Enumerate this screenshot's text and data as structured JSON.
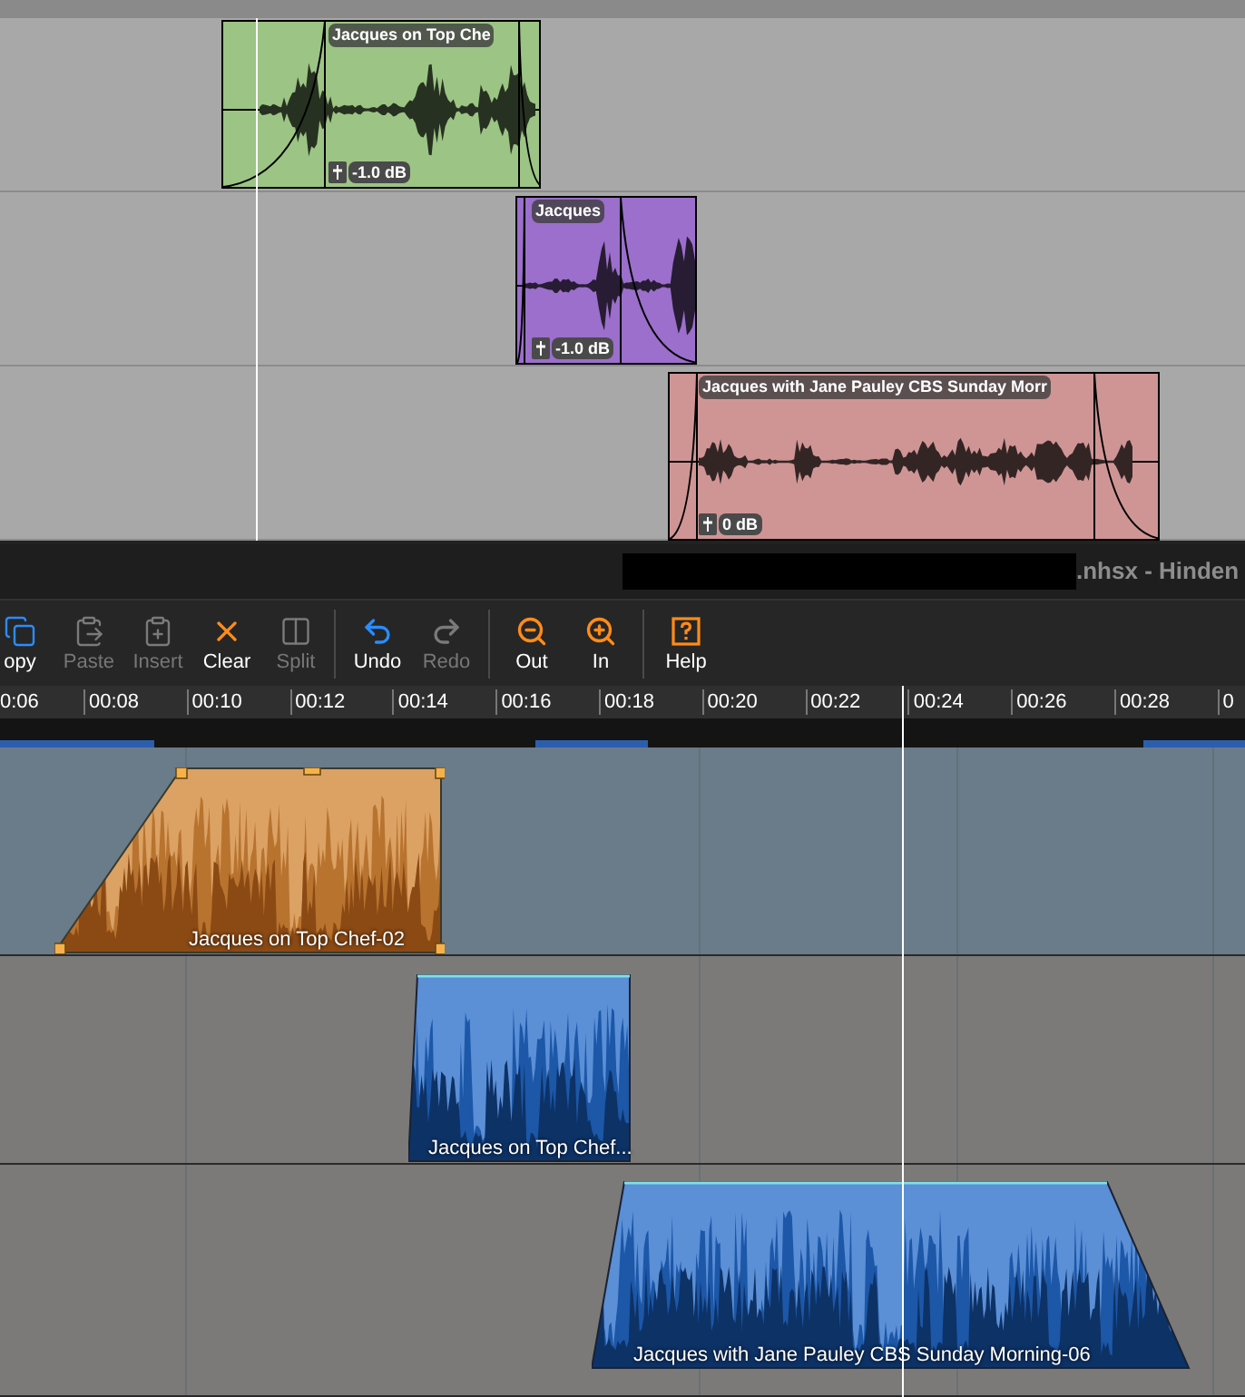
{
  "top_tracks": [
    {
      "clip": {
        "label": "Jacques on Top Che",
        "gain": "-1.0 dB",
        "color": "#9cc485"
      }
    },
    {
      "clip": {
        "label": "Jacques",
        "gain": "-1.0 dB",
        "color": "#9b6fcb"
      }
    },
    {
      "clip": {
        "label": "Jacques with Jane Pauley CBS Sunday Morr",
        "gain": "0 dB",
        "color": "#cf9595"
      }
    }
  ],
  "title_bar": {
    "title": ".nhsx - Hinden"
  },
  "toolbar": [
    [
      {
        "kind": "copy",
        "label": "opy",
        "disabled": false
      },
      {
        "kind": "paste",
        "label": "Paste",
        "disabled": true
      },
      {
        "kind": "insert",
        "label": "Insert",
        "disabled": true
      },
      {
        "kind": "clear",
        "label": "Clear",
        "disabled": false
      },
      {
        "kind": "split",
        "label": "Split",
        "disabled": true
      }
    ],
    [
      {
        "kind": "undo",
        "label": "Undo",
        "disabled": false
      },
      {
        "kind": "redo",
        "label": "Redo",
        "disabled": true
      }
    ],
    [
      {
        "kind": "zoom_out",
        "label": "Out",
        "disabled": false
      },
      {
        "kind": "zoom_in",
        "label": "In",
        "disabled": false
      }
    ],
    [
      {
        "kind": "help",
        "label": "Help",
        "disabled": false
      }
    ]
  ],
  "ruler": {
    "ticks": [
      "0:06",
      "00:08",
      "00:10",
      "00:12",
      "00:14",
      "00:16",
      "00:18",
      "00:20",
      "00:22",
      "00:24",
      "00:26",
      "00:28",
      "0"
    ]
  },
  "bottom_tracks": [
    {
      "clip": {
        "label": "Jacques on Top Chef-02",
        "selected": true,
        "color": "#dba264"
      }
    },
    {
      "clip": {
        "label": "Jacques on Top Chef...",
        "selected": false,
        "color": "#5b8fd6"
      }
    },
    {
      "clip": {
        "label": "Jacques with Jane Pauley CBS Sunday Morning-06",
        "selected": false,
        "color": "#5b8fd6"
      }
    }
  ]
}
